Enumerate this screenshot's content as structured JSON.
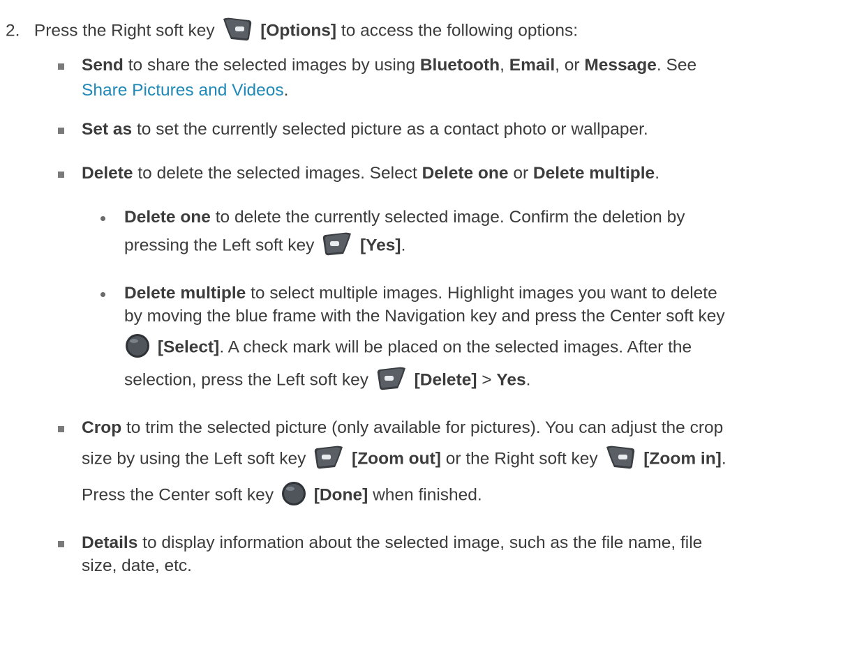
{
  "step": {
    "number": "2.",
    "a": "Press the Right soft key",
    "b": "[Options]",
    "c": "to access the following options:"
  },
  "send": {
    "t1": "Send",
    "t2": "to share the selected images by using",
    "t3": "Bluetooth",
    "t4": ",",
    "t5": "Email",
    "t6": ", or",
    "t7": "Message",
    "t8": ". See",
    "link": "Share Pictures and Videos",
    "t9": "."
  },
  "setas": {
    "t1": "Set as",
    "t2": "to set the currently selected picture as a contact photo or wallpaper."
  },
  "delete": {
    "t1": "Delete",
    "t2": "to delete the selected images. Select",
    "t3": "Delete one",
    "t4": "or",
    "t5": "Delete multiple",
    "t6": "."
  },
  "delete_one": {
    "t1": "Delete one",
    "t2": "to delete the currently selected image. Confirm the deletion by",
    "t3": "pressing the Left soft key",
    "t4": "[Yes]",
    "t5": "."
  },
  "delete_multiple": {
    "t1": "Delete multiple",
    "t2": "to select multiple images. Highlight images you want to delete",
    "t3": "by moving the blue frame with the Navigation key and press the Center soft key",
    "t4": "[Select]",
    "t5": ". A check mark will be placed on the selected images. After the",
    "t6": "selection, press the Left soft key",
    "t7": "[Delete]",
    "t8": ">",
    "t9": "Yes",
    "t10": "."
  },
  "crop": {
    "t1": "Crop",
    "t2": "to trim the selected picture (only available for pictures). You can adjust the crop",
    "t3": "size by using the Left soft key",
    "t4": "[Zoom out]",
    "t5": "or the Right soft key",
    "t6": "[Zoom in]",
    "t7": ".",
    "t8": "Press the Center soft key",
    "t9": "[Done]",
    "t10": "when finished."
  },
  "details": {
    "t1": "Details",
    "t2": "to display information about the selected image, such as the file name, file",
    "t3": "size, date, etc."
  },
  "icons": [
    "right-soft-key-icon",
    "left-soft-key-icon",
    "center-soft-key-icon"
  ]
}
